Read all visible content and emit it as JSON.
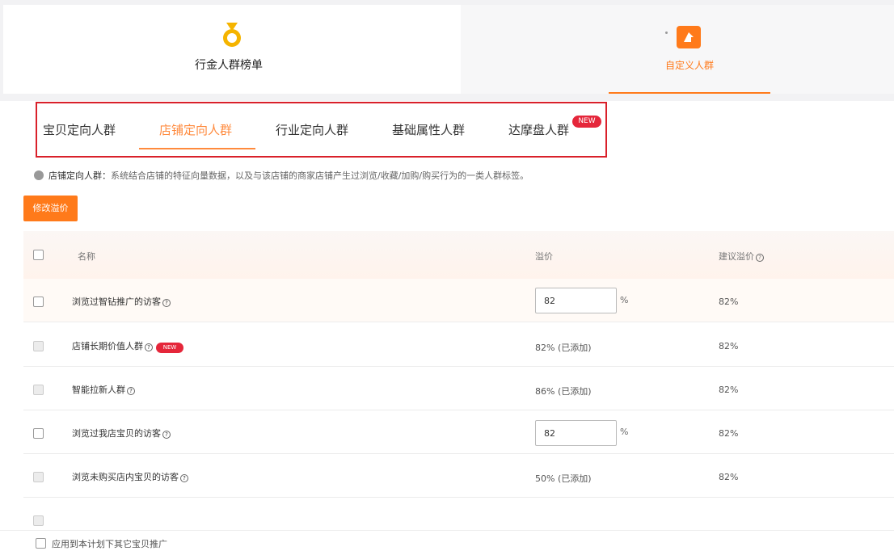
{
  "header": {
    "left_label": "行金人群榜单",
    "right_label": "自定义人群",
    "accent_color": "#ff7a1a",
    "icons": {
      "left": "medal-icon",
      "right": "flag-icon"
    }
  },
  "tabs": [
    {
      "label": "宝贝定向人群",
      "active": false
    },
    {
      "label": "店铺定向人群",
      "active": true
    },
    {
      "label": "行业定向人群",
      "active": false
    },
    {
      "label": "基础属性人群",
      "active": false
    },
    {
      "label": "达摩盘人群",
      "active": false,
      "badge": "NEW"
    }
  ],
  "info": {
    "title": "店铺定向人群：",
    "text": "系统结合店铺的特征向量数据，以及与该店铺的商家店铺产生过浏览/收藏/加购/购买行为的一类人群标签。"
  },
  "toolbar": {
    "batch_button": "修改溢价"
  },
  "table": {
    "headers": {
      "name": "名称",
      "premium": "溢价",
      "suggested": "建议溢价"
    },
    "rows": [
      {
        "name": "浏览过智钻推广的访客",
        "help": true,
        "checkbox": "enabled",
        "premium_input": "82",
        "premium_unit": "%",
        "premium_text": "",
        "suggested": "82%"
      },
      {
        "name": "店铺长期价值人群",
        "help": true,
        "badge": "NEW",
        "checkbox": "disabled",
        "premium_input": "",
        "premium_unit": "",
        "premium_text": "82% (已添加)",
        "suggested": "82%"
      },
      {
        "name": "智能拉新人群",
        "help": true,
        "checkbox": "disabled",
        "premium_input": "",
        "premium_unit": "",
        "premium_text": "86% (已添加)",
        "suggested": "82%"
      },
      {
        "name": "浏览过我店宝贝的访客",
        "help": true,
        "checkbox": "enabled",
        "premium_input": "82",
        "premium_unit": "%",
        "premium_text": "",
        "suggested": "82%"
      },
      {
        "name": "浏览未购买店内宝贝的访客",
        "help": true,
        "checkbox": "disabled",
        "premium_input": "",
        "premium_unit": "",
        "premium_text": "50% (已添加)",
        "suggested": "82%"
      }
    ]
  },
  "footer": {
    "label": "应用到本计划下其它宝贝推广"
  }
}
